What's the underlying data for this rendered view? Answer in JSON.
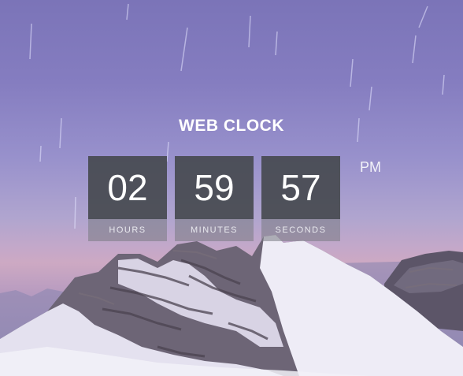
{
  "title": "WEB CLOCK",
  "time": {
    "hours": "02",
    "minutes": "59",
    "seconds": "57",
    "meridiem": "PM"
  },
  "labels": {
    "hours": "HOURS",
    "minutes": "MINUTES",
    "seconds": "SECONDS"
  },
  "colors": {
    "block_bg": "#464a50",
    "label_bg": "#787a82"
  }
}
